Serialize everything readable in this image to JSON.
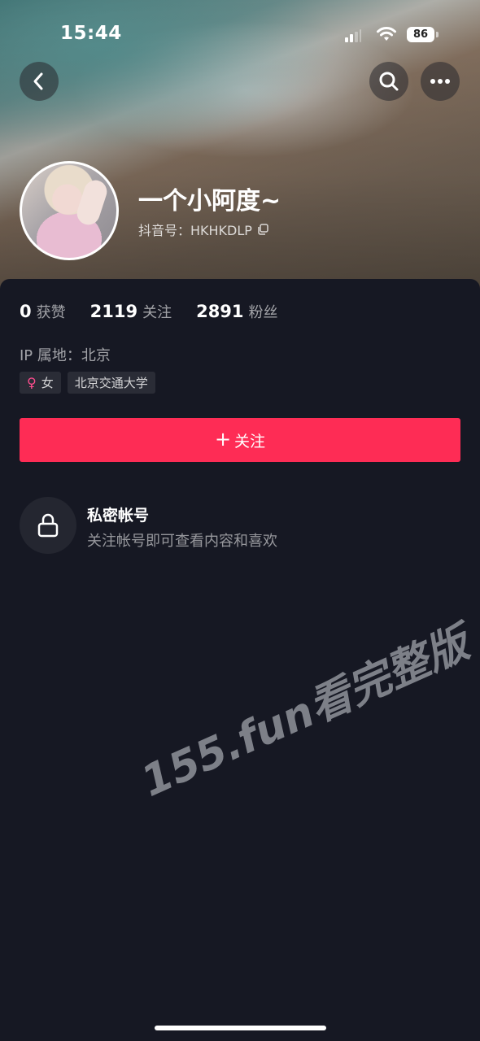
{
  "status_bar": {
    "time": "15:44",
    "battery": "86"
  },
  "header": {
    "back_icon": "chevron-left-icon",
    "search_icon": "search-icon",
    "more_icon": "more-dots-icon"
  },
  "profile": {
    "nickname": "一个小阿度~",
    "douyin_id": "抖音号：HKHKDLP",
    "copy_icon": "copy-icon"
  },
  "stats": [
    {
      "value": "0",
      "label": "获赞"
    },
    {
      "value": "2119",
      "label": "关注"
    },
    {
      "value": "2891",
      "label": "粉丝"
    }
  ],
  "ip_location": "IP 属地：北京",
  "tags": {
    "gender": "女",
    "gender_color": "#ff4d8f",
    "school": "北京交通大学"
  },
  "follow_button": {
    "plus": "+",
    "label": "关注",
    "color": "#fe2c55"
  },
  "private_account": {
    "title": "私密帐号",
    "description": "关注帐号即可查看内容和喜欢"
  },
  "watermark": "155.fun看完整版"
}
